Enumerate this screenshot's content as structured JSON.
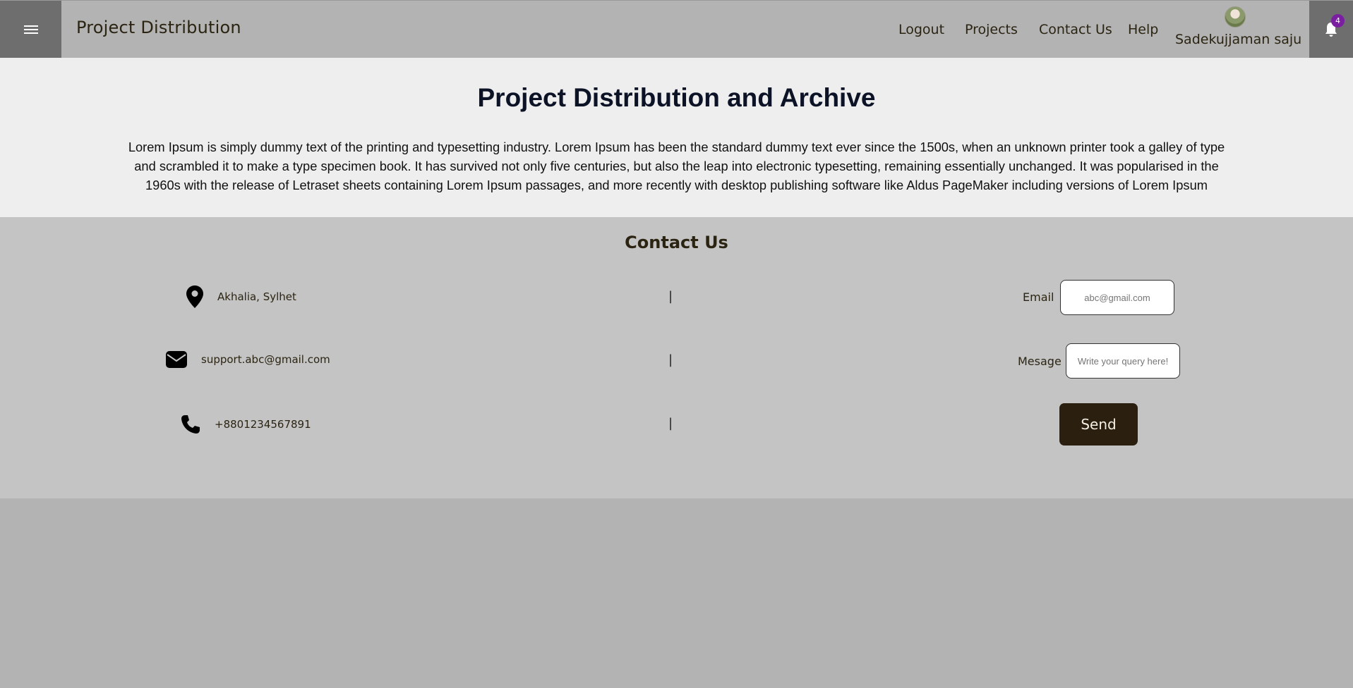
{
  "header": {
    "brand": "Project Distribution",
    "nav": {
      "logout": "Logout",
      "projects": "Projects",
      "contact": "Contact Us",
      "help": "Help"
    },
    "user_name": "Sadekujjaman saju",
    "notification_count": "4"
  },
  "intro": {
    "title": "Project Distribution and Archive",
    "text": "Lorem Ipsum is simply dummy text of the printing and typesetting industry. Lorem Ipsum has been the standard dummy text ever since the 1500s, when an unknown printer took a galley of type and scrambled it to make a type specimen book. It has survived not only five centuries, but also the leap into electronic typesetting, remaining essentially unchanged. It was popularised in the 1960s with the release of Letraset sheets containing Lorem Ipsum passages, and more recently with desktop publishing software like Aldus PageMaker including versions of Lorem Ipsum"
  },
  "contact": {
    "title": "Contact Us",
    "address": "Akhalia, Sylhet",
    "email": "support.abc@gmail.com",
    "phone": "+8801234567891",
    "separator": "|",
    "form": {
      "email_label": "Email",
      "email_placeholder": "abc@gmail.com",
      "message_label": "Mesage",
      "message_placeholder": "Write your query here!",
      "send_label": "Send"
    }
  },
  "colors": {
    "header_bg": "#b3b3b3",
    "header_side_bg": "#6e6e6e",
    "intro_bg": "#eeeeee",
    "contact_bg": "#c4c4c4",
    "send_button_bg": "#2b1f10",
    "badge_bg": "#7b1fa2"
  },
  "icons": {
    "menu": "hamburger-icon",
    "bell": "bell-icon",
    "location": "map-pin-icon",
    "mail": "envelope-icon",
    "phone": "phone-icon"
  }
}
